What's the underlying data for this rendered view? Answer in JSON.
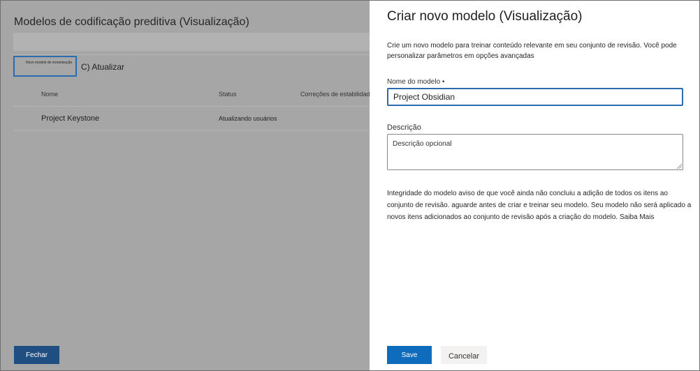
{
  "background": {
    "title": "Modelos de codificação preditiva (Visualização)",
    "new_model_label": "Novo modelo de monetização",
    "refresh_label": "C) Atualizar",
    "columns": [
      "Nome",
      "Status",
      "Correções de estabilidade"
    ],
    "rows": [
      {
        "name": "Project Keystone",
        "status": "Atualizando usuários"
      }
    ],
    "close_label": "Fechar"
  },
  "panel": {
    "title": "Criar novo modelo (Visualização)",
    "description": "Crie um novo modelo para treinar conteúdo relevante em seu conjunto de revisão. Você pode personalizar parâmetros em opções avançadas",
    "name_label": "Nome do modelo •",
    "name_value": "Project Obsidian",
    "description_label": "Descrição",
    "description_placeholder": "Descrição opcional",
    "warning": "Integridade do modelo aviso de que você ainda não concluiu a adição de todos os itens ao conjunto de revisão. aguarde antes de criar e treinar seu modelo. Seu modelo não será aplicado a novos itens adicionados ao conjunto de revisão após a criação do modelo.",
    "learn_more": "Saiba Mais",
    "save_label": "Save",
    "cancel_label": "Cancelar"
  },
  "colors": {
    "overlay": "#a6a6a6",
    "primary": "#0f6cbd",
    "close_button": "#1f4e83",
    "focus_border": "#2b6cb0"
  }
}
